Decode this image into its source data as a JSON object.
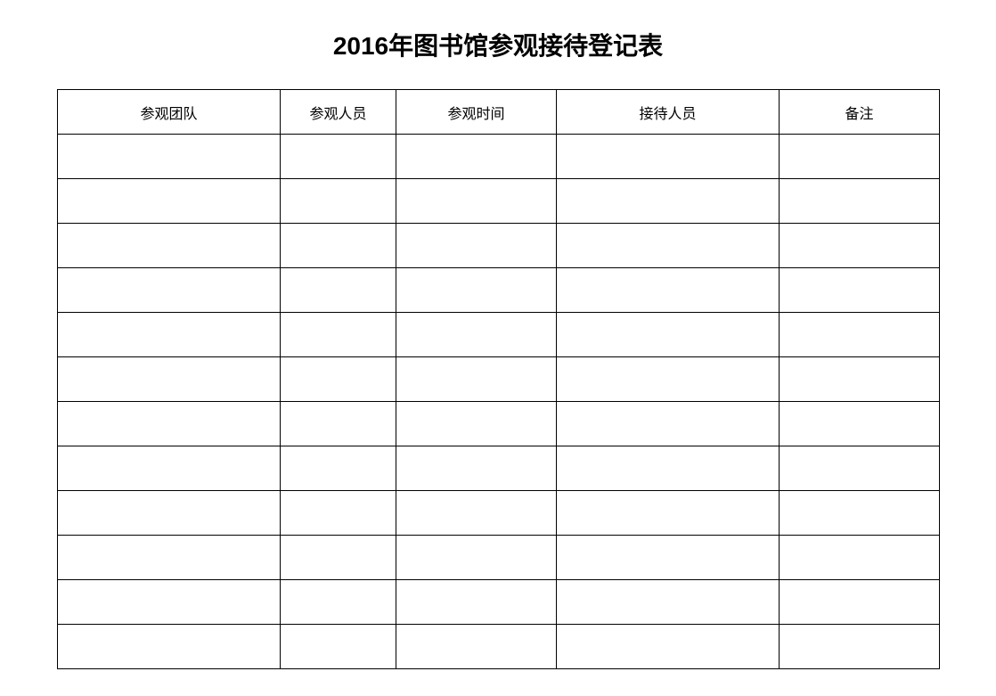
{
  "title": "2016年图书馆参观接待登记表",
  "headers": {
    "col1": "参观团队",
    "col2": "参观人员",
    "col3": "参观时间",
    "col4": "接待人员",
    "col5": "备注"
  },
  "rows": [
    {
      "col1": "",
      "col2": "",
      "col3": "",
      "col4": "",
      "col5": ""
    },
    {
      "col1": "",
      "col2": "",
      "col3": "",
      "col4": "",
      "col5": ""
    },
    {
      "col1": "",
      "col2": "",
      "col3": "",
      "col4": "",
      "col5": ""
    },
    {
      "col1": "",
      "col2": "",
      "col3": "",
      "col4": "",
      "col5": ""
    },
    {
      "col1": "",
      "col2": "",
      "col3": "",
      "col4": "",
      "col5": ""
    },
    {
      "col1": "",
      "col2": "",
      "col3": "",
      "col4": "",
      "col5": ""
    },
    {
      "col1": "",
      "col2": "",
      "col3": "",
      "col4": "",
      "col5": ""
    },
    {
      "col1": "",
      "col2": "",
      "col3": "",
      "col4": "",
      "col5": ""
    },
    {
      "col1": "",
      "col2": "",
      "col3": "",
      "col4": "",
      "col5": ""
    },
    {
      "col1": "",
      "col2": "",
      "col3": "",
      "col4": "",
      "col5": ""
    },
    {
      "col1": "",
      "col2": "",
      "col3": "",
      "col4": "",
      "col5": ""
    },
    {
      "col1": "",
      "col2": "",
      "col3": "",
      "col4": "",
      "col5": ""
    }
  ]
}
